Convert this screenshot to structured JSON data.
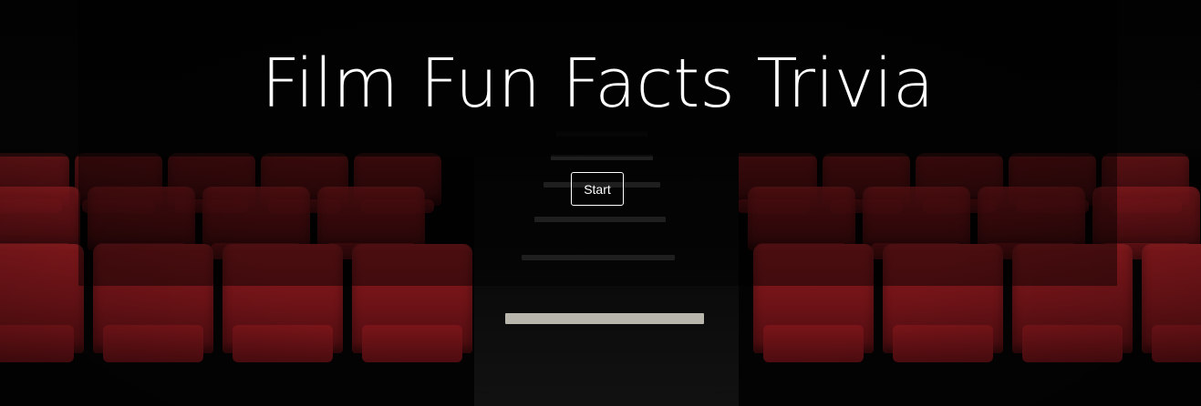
{
  "page": {
    "title": "Film Fun Facts Trivia",
    "start_label": "Start"
  },
  "background": {
    "description_icon": "theater-seats-image"
  },
  "colors": {
    "seat_red": "#8c1a1e",
    "overlay": "rgba(0,0,0,0.45)",
    "text": "#ffffff"
  }
}
